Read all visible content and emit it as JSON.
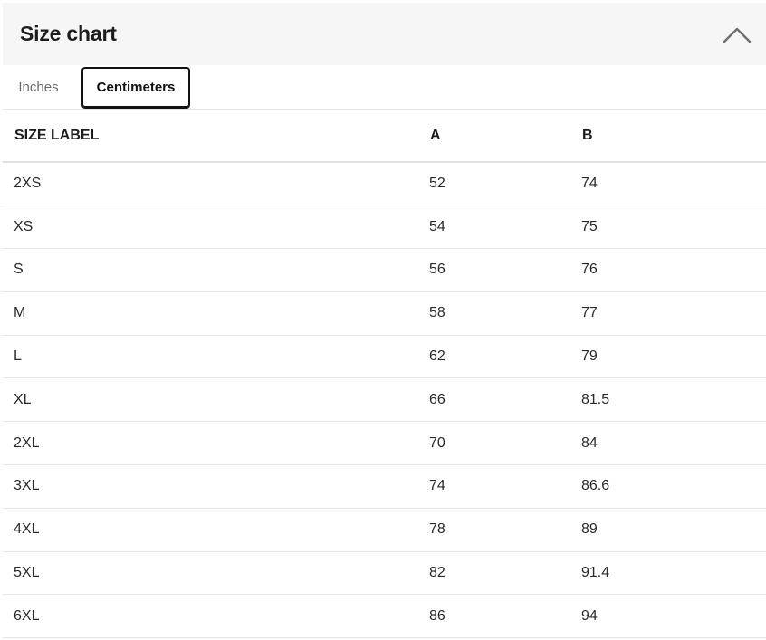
{
  "header": {
    "title": "Size chart"
  },
  "tabs": [
    {
      "label": "Inches",
      "active": false
    },
    {
      "label": "Centimeters",
      "active": true
    }
  ],
  "table": {
    "columns": [
      "SIZE LABEL",
      "A",
      "B"
    ],
    "rows": [
      [
        "2XS",
        "52",
        "74"
      ],
      [
        "XS",
        "54",
        "75"
      ],
      [
        "S",
        "56",
        "76"
      ],
      [
        "M",
        "58",
        "77"
      ],
      [
        "L",
        "62",
        "79"
      ],
      [
        "XL",
        "66",
        "81.5"
      ],
      [
        "2XL",
        "70",
        "84"
      ],
      [
        "3XL",
        "74",
        "86.6"
      ],
      [
        "4XL",
        "78",
        "89"
      ],
      [
        "5XL",
        "82",
        "91.4"
      ],
      [
        "6XL",
        "86",
        "94"
      ]
    ]
  },
  "icons": {
    "collapse": "chevron-up-icon"
  },
  "colors": {
    "header_bg": "#f6f6f6",
    "active_tab_border": "#111111",
    "inactive_tab_text": "#6b6b6b",
    "row_divider": "#e6e6e6"
  }
}
